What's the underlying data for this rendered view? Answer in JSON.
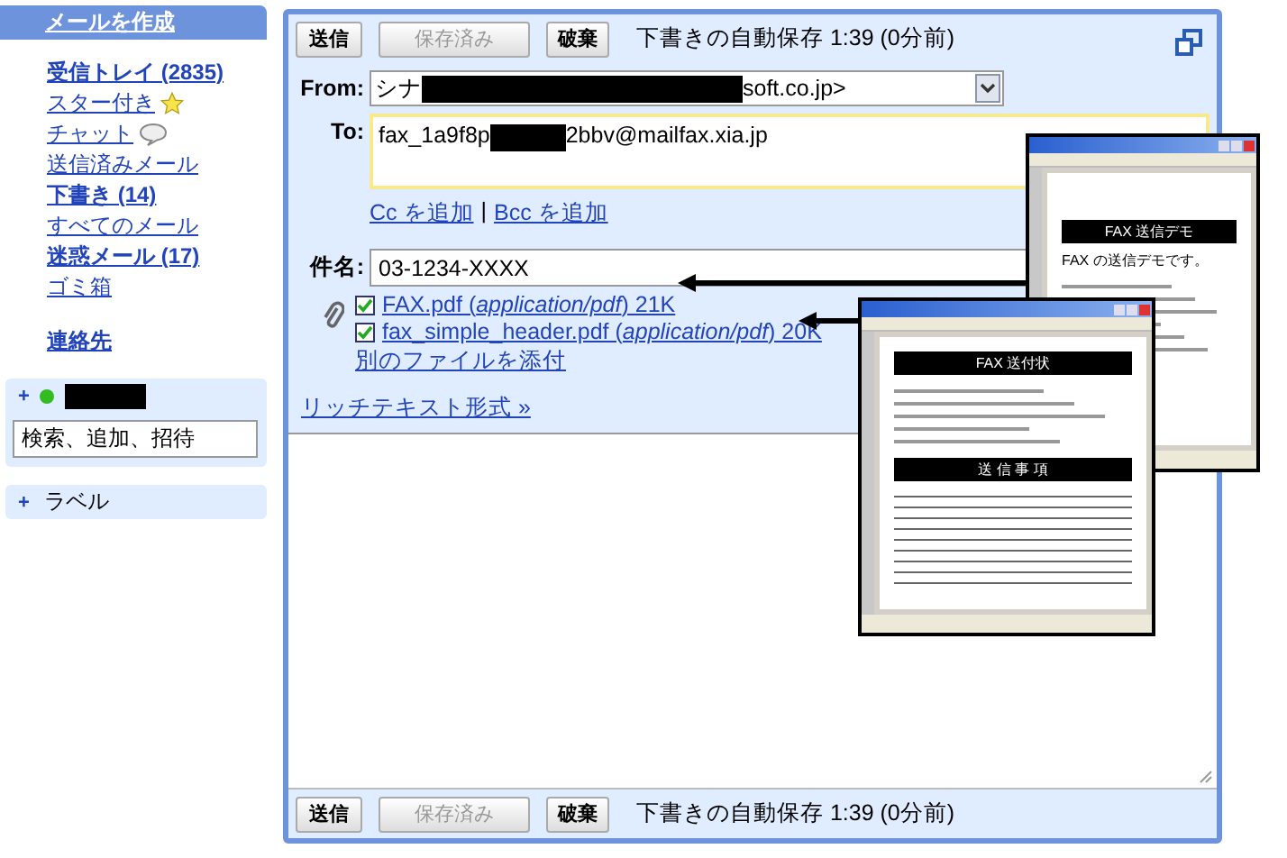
{
  "sidebar": {
    "compose": "メールを作成",
    "items": [
      {
        "label": "受信トレイ (2835)",
        "bold": true,
        "kind": "plain"
      },
      {
        "label": "スター付き",
        "bold": false,
        "kind": "starred"
      },
      {
        "label": "チャット",
        "bold": false,
        "kind": "chat"
      },
      {
        "label": "送信済みメール",
        "bold": false,
        "kind": "plain"
      },
      {
        "label": "下書き (14)",
        "bold": true,
        "kind": "plain"
      },
      {
        "label": "すべてのメール",
        "bold": false,
        "kind": "plain"
      },
      {
        "label": "迷惑メール (17)",
        "bold": true,
        "kind": "plain"
      },
      {
        "label": "ゴミ箱",
        "bold": false,
        "kind": "plain"
      }
    ],
    "contacts": "連絡先",
    "chat": {
      "expand": "+",
      "search_value": "検索、追加、招待"
    },
    "labels": {
      "expand": "+",
      "title": "ラベル"
    }
  },
  "compose": {
    "top_bar": {
      "buttons": [
        {
          "label": "送信",
          "disabled": false
        },
        {
          "label": "保存済み",
          "disabled": true
        },
        {
          "label": "破棄",
          "disabled": false
        }
      ],
      "autosave": "下書きの自動保存 1:39 (0分前)"
    },
    "from": {
      "label": "From:",
      "value_start": "シナ",
      "value_end": "soft.co.jp>"
    },
    "to": {
      "label": "To:",
      "value_start": "fax_1a9f8p",
      "value_end": "2bbv@mailfax.xia.jp"
    },
    "cc_links": [
      "Cc を追加",
      "Bcc を追加"
    ],
    "cc_separator": "|",
    "subject": {
      "label": "件名:",
      "value": "03-1234-XXXX"
    },
    "attachments": [
      {
        "checked": true,
        "text": "FAX.pdf (*application/pdf*) 21K"
      },
      {
        "checked": true,
        "text": "fax_simple_header.pdf (*application/pdf*) 20K"
      }
    ],
    "attach_another": "別のファイルを添付",
    "rich_text": "リッチテキスト形式 »",
    "bottom_bar": {
      "buttons": [
        {
          "label": "送信",
          "disabled": false
        },
        {
          "label": "保存済み",
          "disabled": true
        },
        {
          "label": "破棄",
          "disabled": false
        }
      ],
      "autosave": "下書きの自動保存 1:39 (0分前)"
    }
  },
  "pdf_windows": [
    {
      "heading": "FAX 送信デモ",
      "intro": "FAX の送信デモです。"
    },
    {
      "heading": "FAX 送付状",
      "section": "送 信 事 項"
    }
  ]
}
